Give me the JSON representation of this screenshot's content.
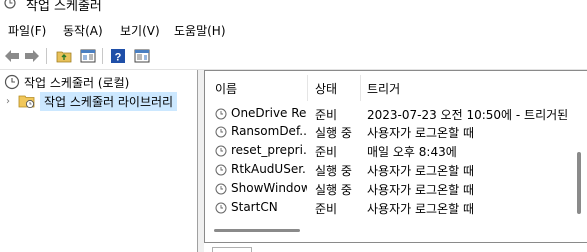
{
  "window": {
    "title": "작업 스케줄러"
  },
  "menu": [
    "파일(F)",
    "동작(A)",
    "보기(V)",
    "도움말(H)"
  ],
  "toolbar": {
    "icons": [
      "back-arrow-icon",
      "forward-arrow-icon",
      "folder-up-icon",
      "show-hide-pane-icon",
      "help-icon",
      "properties-pane-icon"
    ]
  },
  "tree": {
    "root": "작업 스케줄러 (로컬)",
    "child": "작업 스케줄러 라이브러리"
  },
  "list": {
    "columns": [
      "이름",
      "상태",
      "트리거"
    ],
    "rows": [
      {
        "name": "OneDrive Re...",
        "status": "준비",
        "trigger": "2023-07-23 오전 10:50에 - 트리거된"
      },
      {
        "name": "RansomDef...",
        "status": "실행 중",
        "trigger": "사용자가 로그온할 때"
      },
      {
        "name": "reset_prepri...",
        "status": "준비",
        "trigger": "매일 오후 8:43에"
      },
      {
        "name": "RtkAudUSer...",
        "status": "실행 중",
        "trigger": "사용자가 로그온할 때"
      },
      {
        "name": "ShowWindow",
        "status": "실행 중",
        "trigger": "사용자가 로그온할 때"
      },
      {
        "name": "StartCN",
        "status": "준비",
        "trigger": "사용자가 로그온할 때"
      }
    ]
  },
  "colors": {
    "selection": "#cce8ff",
    "border": "#8a8a8a"
  }
}
